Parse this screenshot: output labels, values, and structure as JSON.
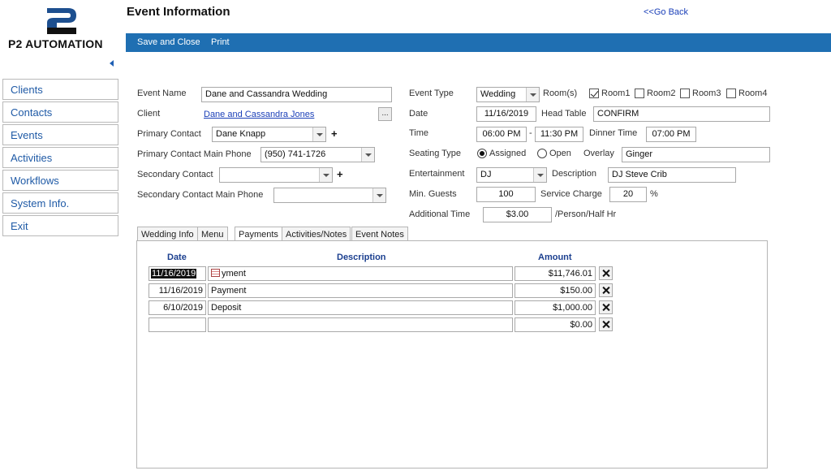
{
  "app": {
    "logo_text": "P2 AUTOMATION",
    "title": "Event Information",
    "go_back": "<<Go Back"
  },
  "toolbar": {
    "save_close": "Save and Close",
    "print": "Print"
  },
  "sidebar": {
    "items": [
      {
        "label": "Clients"
      },
      {
        "label": "Contacts"
      },
      {
        "label": "Events"
      },
      {
        "label": "Activities"
      },
      {
        "label": "Workflows"
      },
      {
        "label": "System Info."
      },
      {
        "label": "Exit"
      }
    ]
  },
  "form": {
    "event_name": {
      "label": "Event Name",
      "value": "Dane and Cassandra Wedding"
    },
    "client": {
      "label": "Client",
      "value": "Dane and Cassandra Jones",
      "button": "..."
    },
    "primary_contact": {
      "label": "Primary Contact",
      "value": "Dane Knapp",
      "add": "+"
    },
    "primary_phone": {
      "label": "Primary Contact Main Phone",
      "value": "(950) 741-1726"
    },
    "secondary_contact": {
      "label": "Secondary Contact",
      "value": "",
      "add": "+"
    },
    "secondary_phone": {
      "label": "Secondary Contact Main Phone",
      "value": ""
    },
    "event_type": {
      "label": "Event Type",
      "value": "Wedding"
    },
    "rooms": {
      "label": "Room(s)",
      "items": [
        {
          "label": "Room1",
          "checked": true
        },
        {
          "label": "Room2",
          "checked": false
        },
        {
          "label": "Room3",
          "checked": false
        },
        {
          "label": "Room4",
          "checked": false
        }
      ]
    },
    "date": {
      "label": "Date",
      "value": "11/16/2019"
    },
    "head_table": {
      "label": "Head Table",
      "value": "CONFIRM"
    },
    "time": {
      "label": "Time",
      "start": "06:00 PM",
      "separator": "-",
      "end": "11:30 PM"
    },
    "dinner_time": {
      "label": "Dinner Time",
      "value": "07:00 PM"
    },
    "seating_type": {
      "label": "Seating Type",
      "options": [
        {
          "label": "Assigned",
          "selected": true
        },
        {
          "label": "Open",
          "selected": false
        }
      ]
    },
    "overlay": {
      "label": "Overlay",
      "value": "Ginger"
    },
    "entertainment": {
      "label": "Entertainment",
      "value": "DJ"
    },
    "description": {
      "label": "Description",
      "value": "DJ Steve Crib"
    },
    "min_guests": {
      "label": "Min. Guests",
      "value": "100"
    },
    "service_charge": {
      "label": "Service Charge",
      "value": "20",
      "unit": "%"
    },
    "additional_time": {
      "label": "Additional Time",
      "value": "$3.00",
      "unit": "/Person/Half Hr"
    }
  },
  "tabs": [
    {
      "label": "Wedding Info",
      "active": false
    },
    {
      "label": "Menu",
      "active": false
    },
    {
      "label": "Payments",
      "active": true
    },
    {
      "label": "Activities/Notes",
      "active": false
    },
    {
      "label": "Event Notes",
      "active": false
    }
  ],
  "payments": {
    "headers": {
      "date": "Date",
      "description": "Description",
      "amount": "Amount"
    },
    "rows": [
      {
        "date": "11/16/2019",
        "description": "yment",
        "amount": "$11,746.01"
      },
      {
        "date": "11/16/2019",
        "description": "Payment",
        "amount": "$150.00"
      },
      {
        "date": "6/10/2019",
        "description": "Deposit",
        "amount": "$1,000.00"
      },
      {
        "date": "",
        "description": "",
        "amount": "$0.00"
      }
    ]
  },
  "colors": {
    "toolbar": "#1f6fb2",
    "link": "#1a3fb8",
    "sidebar_text": "#1f5aa6",
    "header_text": "#1b3f8f"
  }
}
